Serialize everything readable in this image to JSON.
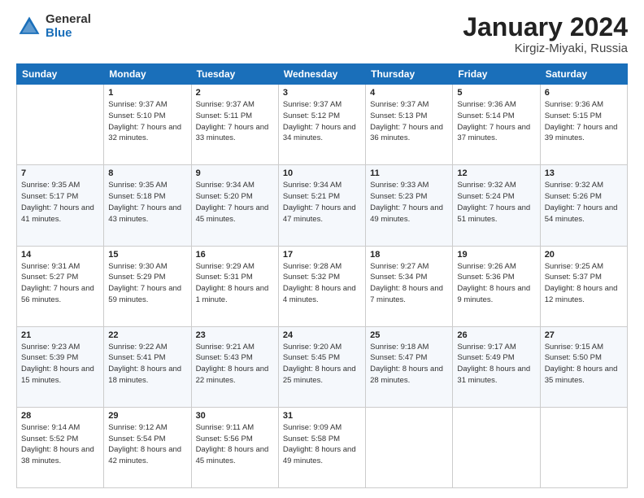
{
  "logo": {
    "general": "General",
    "blue": "Blue"
  },
  "title": {
    "month": "January 2024",
    "location": "Kirgiz-Miyaki, Russia"
  },
  "weekdays": [
    "Sunday",
    "Monday",
    "Tuesday",
    "Wednesday",
    "Thursday",
    "Friday",
    "Saturday"
  ],
  "weeks": [
    [
      {
        "day": "",
        "sunrise": "",
        "sunset": "",
        "daylight": ""
      },
      {
        "day": "1",
        "sunrise": "Sunrise: 9:37 AM",
        "sunset": "Sunset: 5:10 PM",
        "daylight": "Daylight: 7 hours and 32 minutes."
      },
      {
        "day": "2",
        "sunrise": "Sunrise: 9:37 AM",
        "sunset": "Sunset: 5:11 PM",
        "daylight": "Daylight: 7 hours and 33 minutes."
      },
      {
        "day": "3",
        "sunrise": "Sunrise: 9:37 AM",
        "sunset": "Sunset: 5:12 PM",
        "daylight": "Daylight: 7 hours and 34 minutes."
      },
      {
        "day": "4",
        "sunrise": "Sunrise: 9:37 AM",
        "sunset": "Sunset: 5:13 PM",
        "daylight": "Daylight: 7 hours and 36 minutes."
      },
      {
        "day": "5",
        "sunrise": "Sunrise: 9:36 AM",
        "sunset": "Sunset: 5:14 PM",
        "daylight": "Daylight: 7 hours and 37 minutes."
      },
      {
        "day": "6",
        "sunrise": "Sunrise: 9:36 AM",
        "sunset": "Sunset: 5:15 PM",
        "daylight": "Daylight: 7 hours and 39 minutes."
      }
    ],
    [
      {
        "day": "7",
        "sunrise": "Sunrise: 9:35 AM",
        "sunset": "Sunset: 5:17 PM",
        "daylight": "Daylight: 7 hours and 41 minutes."
      },
      {
        "day": "8",
        "sunrise": "Sunrise: 9:35 AM",
        "sunset": "Sunset: 5:18 PM",
        "daylight": "Daylight: 7 hours and 43 minutes."
      },
      {
        "day": "9",
        "sunrise": "Sunrise: 9:34 AM",
        "sunset": "Sunset: 5:20 PM",
        "daylight": "Daylight: 7 hours and 45 minutes."
      },
      {
        "day": "10",
        "sunrise": "Sunrise: 9:34 AM",
        "sunset": "Sunset: 5:21 PM",
        "daylight": "Daylight: 7 hours and 47 minutes."
      },
      {
        "day": "11",
        "sunrise": "Sunrise: 9:33 AM",
        "sunset": "Sunset: 5:23 PM",
        "daylight": "Daylight: 7 hours and 49 minutes."
      },
      {
        "day": "12",
        "sunrise": "Sunrise: 9:32 AM",
        "sunset": "Sunset: 5:24 PM",
        "daylight": "Daylight: 7 hours and 51 minutes."
      },
      {
        "day": "13",
        "sunrise": "Sunrise: 9:32 AM",
        "sunset": "Sunset: 5:26 PM",
        "daylight": "Daylight: 7 hours and 54 minutes."
      }
    ],
    [
      {
        "day": "14",
        "sunrise": "Sunrise: 9:31 AM",
        "sunset": "Sunset: 5:27 PM",
        "daylight": "Daylight: 7 hours and 56 minutes."
      },
      {
        "day": "15",
        "sunrise": "Sunrise: 9:30 AM",
        "sunset": "Sunset: 5:29 PM",
        "daylight": "Daylight: 7 hours and 59 minutes."
      },
      {
        "day": "16",
        "sunrise": "Sunrise: 9:29 AM",
        "sunset": "Sunset: 5:31 PM",
        "daylight": "Daylight: 8 hours and 1 minute."
      },
      {
        "day": "17",
        "sunrise": "Sunrise: 9:28 AM",
        "sunset": "Sunset: 5:32 PM",
        "daylight": "Daylight: 8 hours and 4 minutes."
      },
      {
        "day": "18",
        "sunrise": "Sunrise: 9:27 AM",
        "sunset": "Sunset: 5:34 PM",
        "daylight": "Daylight: 8 hours and 7 minutes."
      },
      {
        "day": "19",
        "sunrise": "Sunrise: 9:26 AM",
        "sunset": "Sunset: 5:36 PM",
        "daylight": "Daylight: 8 hours and 9 minutes."
      },
      {
        "day": "20",
        "sunrise": "Sunrise: 9:25 AM",
        "sunset": "Sunset: 5:37 PM",
        "daylight": "Daylight: 8 hours and 12 minutes."
      }
    ],
    [
      {
        "day": "21",
        "sunrise": "Sunrise: 9:23 AM",
        "sunset": "Sunset: 5:39 PM",
        "daylight": "Daylight: 8 hours and 15 minutes."
      },
      {
        "day": "22",
        "sunrise": "Sunrise: 9:22 AM",
        "sunset": "Sunset: 5:41 PM",
        "daylight": "Daylight: 8 hours and 18 minutes."
      },
      {
        "day": "23",
        "sunrise": "Sunrise: 9:21 AM",
        "sunset": "Sunset: 5:43 PM",
        "daylight": "Daylight: 8 hours and 22 minutes."
      },
      {
        "day": "24",
        "sunrise": "Sunrise: 9:20 AM",
        "sunset": "Sunset: 5:45 PM",
        "daylight": "Daylight: 8 hours and 25 minutes."
      },
      {
        "day": "25",
        "sunrise": "Sunrise: 9:18 AM",
        "sunset": "Sunset: 5:47 PM",
        "daylight": "Daylight: 8 hours and 28 minutes."
      },
      {
        "day": "26",
        "sunrise": "Sunrise: 9:17 AM",
        "sunset": "Sunset: 5:49 PM",
        "daylight": "Daylight: 8 hours and 31 minutes."
      },
      {
        "day": "27",
        "sunrise": "Sunrise: 9:15 AM",
        "sunset": "Sunset: 5:50 PM",
        "daylight": "Daylight: 8 hours and 35 minutes."
      }
    ],
    [
      {
        "day": "28",
        "sunrise": "Sunrise: 9:14 AM",
        "sunset": "Sunset: 5:52 PM",
        "daylight": "Daylight: 8 hours and 38 minutes."
      },
      {
        "day": "29",
        "sunrise": "Sunrise: 9:12 AM",
        "sunset": "Sunset: 5:54 PM",
        "daylight": "Daylight: 8 hours and 42 minutes."
      },
      {
        "day": "30",
        "sunrise": "Sunrise: 9:11 AM",
        "sunset": "Sunset: 5:56 PM",
        "daylight": "Daylight: 8 hours and 45 minutes."
      },
      {
        "day": "31",
        "sunrise": "Sunrise: 9:09 AM",
        "sunset": "Sunset: 5:58 PM",
        "daylight": "Daylight: 8 hours and 49 minutes."
      },
      {
        "day": "",
        "sunrise": "",
        "sunset": "",
        "daylight": ""
      },
      {
        "day": "",
        "sunrise": "",
        "sunset": "",
        "daylight": ""
      },
      {
        "day": "",
        "sunrise": "",
        "sunset": "",
        "daylight": ""
      }
    ]
  ]
}
